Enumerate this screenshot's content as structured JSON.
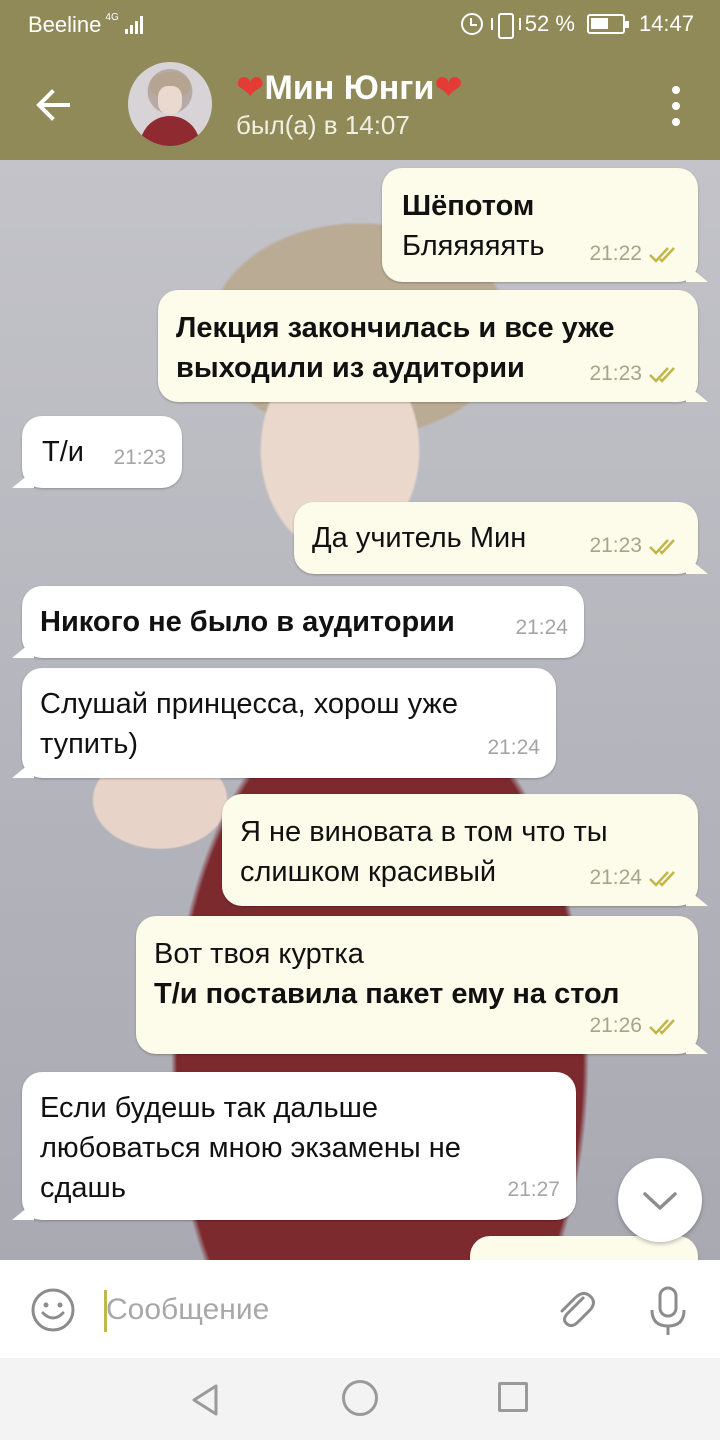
{
  "status_bar": {
    "carrier": "Beeline",
    "network": "4G",
    "battery": "52 %",
    "time": "14:47"
  },
  "header": {
    "heart_left": "❤",
    "name": "Мин Юнги",
    "heart_right": "❤",
    "status": "был(а) в 14:07"
  },
  "messages": [
    {
      "direction": "out",
      "lines": [
        {
          "text": "Шёпотом",
          "bold": true
        },
        {
          "text": "Бляяяяять",
          "bold": false
        }
      ],
      "time": "21:22",
      "read": true
    },
    {
      "direction": "out",
      "lines": [
        {
          "text": "Лекция закончилась и все уже",
          "bold": true
        },
        {
          "text": "выходили из аудитории",
          "bold": true
        }
      ],
      "time": "21:23",
      "read": true
    },
    {
      "direction": "in",
      "lines": [
        {
          "text": "Т/и",
          "bold": false
        }
      ],
      "time": "21:23"
    },
    {
      "direction": "out",
      "lines": [
        {
          "text": "Да учитель Мин",
          "bold": false
        }
      ],
      "time": "21:23",
      "read": true
    },
    {
      "direction": "in",
      "lines": [
        {
          "text": "Никого не было в аудитории",
          "bold": true
        }
      ],
      "time": "21:24"
    },
    {
      "direction": "in",
      "lines": [
        {
          "text": "Слушай принцесса, хорош уже",
          "bold": false
        },
        {
          "text": "тупить)",
          "bold": false
        }
      ],
      "time": "21:24"
    },
    {
      "direction": "out",
      "lines": [
        {
          "text": "Я не виновата в том что ты",
          "bold": false
        },
        {
          "text": "слишком красивый",
          "bold": false
        }
      ],
      "time": "21:24",
      "read": true
    },
    {
      "direction": "out",
      "lines": [
        {
          "text": "Вот твоя куртка",
          "bold": false
        },
        {
          "text": "Т/и поставила пакет ему на стол",
          "bold": true
        }
      ],
      "time": "21:26",
      "read": true
    },
    {
      "direction": "in",
      "lines": [
        {
          "text": "Если будешь так дальше",
          "bold": false
        },
        {
          "text": "любоваться мною экзамены не",
          "bold": false
        },
        {
          "text": "сдашь",
          "bold": false
        }
      ],
      "time": "21:27"
    }
  ],
  "composer": {
    "placeholder": "Сообщение"
  },
  "icons": {
    "back": "arrow-left-icon",
    "menu": "more-vertical-icon",
    "emoji": "smiley-icon",
    "attach": "paperclip-icon",
    "mic": "microphone-icon",
    "scroll_down": "chevron-down-icon",
    "read_receipt": "double-check-icon"
  },
  "colors": {
    "header_bg": "#8f8a58",
    "bubble_out": "#fdfbe9",
    "bubble_in": "#ffffff",
    "heart": "#e43b35",
    "caret": "#c2b74d"
  }
}
